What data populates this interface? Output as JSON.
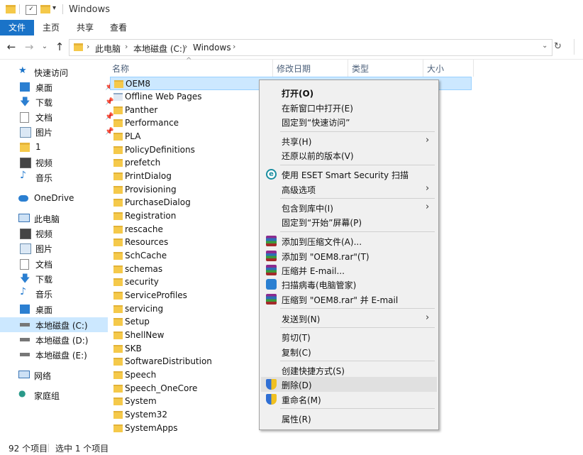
{
  "window": {
    "title": "Windows"
  },
  "ribbon": {
    "tabs": [
      "文件",
      "主页",
      "共享",
      "查看"
    ]
  },
  "address": {
    "crumbs": [
      "此电脑",
      "本地磁盘 (C:)",
      "Windows"
    ]
  },
  "nav": {
    "quick_access": "快速访问",
    "quick_items": [
      "桌面",
      "下载",
      "文档",
      "图片",
      "1",
      "视频",
      "音乐"
    ],
    "onedrive": "OneDrive",
    "this_pc": "此电脑",
    "pc_items": [
      "视频",
      "图片",
      "文档",
      "下载",
      "音乐",
      "桌面",
      "本地磁盘 (C:)",
      "本地磁盘 (D:)",
      "本地磁盘 (E:)"
    ],
    "network": "网络",
    "homegroup": "家庭组"
  },
  "columns": {
    "name": "名称",
    "date": "修改日期",
    "type": "类型",
    "size": "大小"
  },
  "files": [
    "OEM8",
    "Offline Web Pages",
    "Panther",
    "Performance",
    "PLA",
    "PolicyDefinitions",
    "prefetch",
    "PrintDialog",
    "Provisioning",
    "PurchaseDialog",
    "Registration",
    "rescache",
    "Resources",
    "SchCache",
    "schemas",
    "security",
    "ServiceProfiles",
    "servicing",
    "Setup",
    "ShellNew",
    "SKB",
    "SoftwareDistribution",
    "Speech",
    "Speech_OneCore",
    "System",
    "System32",
    "SystemApps"
  ],
  "context_menu": {
    "open": "打开(O)",
    "open_new_window": "在新窗口中打开(E)",
    "pin_quick": "固定到“快速访问”",
    "share": "共享(H)",
    "restore": "还原以前的版本(V)",
    "eset": "使用 ESET Smart Security 扫描",
    "advanced": "高级选项",
    "include_library": "包含到库中(I)",
    "pin_start": "固定到“开始”屏幕(P)",
    "add_archive": "添加到压缩文件(A)...",
    "add_rar": "添加到 \"OEM8.rar\"(T)",
    "compress_email": "压缩并 E-mail...",
    "scan_virus": "扫描病毒(电脑管家)",
    "compress_rar_email": "压缩到 \"OEM8.rar\" 并 E-mail",
    "send_to": "发送到(N)",
    "cut": "剪切(T)",
    "copy": "复制(C)",
    "shortcut": "创建快捷方式(S)",
    "delete": "删除(D)",
    "rename": "重命名(M)",
    "properties": "属性(R)"
  },
  "status": {
    "count": "92 个项目",
    "selected": "选中 1 个项目"
  },
  "colors": {
    "accent": "#1a73c8",
    "selection": "#cce8ff",
    "folder": "#f5c94a"
  }
}
